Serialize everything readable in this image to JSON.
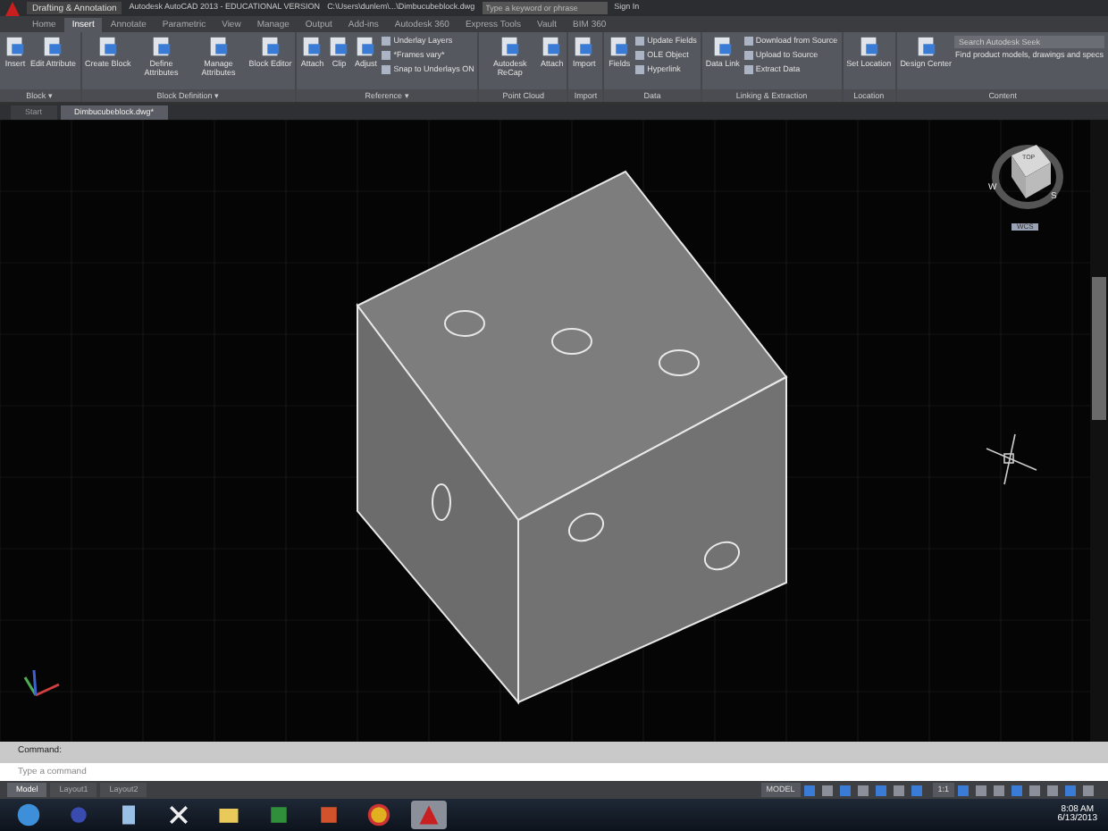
{
  "title_bar": {
    "workspace": "Drafting & Annotation",
    "title": "Autodesk AutoCAD 2013 - EDUCATIONAL VERSION",
    "file": "C:\\Users\\dunlem\\...\\Dimbucubeblock.dwg",
    "search": {
      "placeholder": "Type a keyword or phrase"
    },
    "sign_in": "Sign In"
  },
  "ribbon_tabs": [
    {
      "label": "Home",
      "selected": false
    },
    {
      "label": "Insert",
      "selected": true
    },
    {
      "label": "Annotate",
      "selected": false
    },
    {
      "label": "Parametric",
      "selected": false
    },
    {
      "label": "View",
      "selected": false
    },
    {
      "label": "Manage",
      "selected": false
    },
    {
      "label": "Output",
      "selected": false
    },
    {
      "label": "Add-ins",
      "selected": false
    },
    {
      "label": "Autodesk 360",
      "selected": false
    },
    {
      "label": "Express Tools",
      "selected": false
    },
    {
      "label": "Vault",
      "selected": false
    },
    {
      "label": "BIM 360",
      "selected": false
    }
  ],
  "ribbon_panels": [
    {
      "title": "Block ▾",
      "tools": [
        {
          "kind": "large",
          "label": "Insert"
        },
        {
          "kind": "large",
          "label": "Edit Attribute"
        }
      ]
    },
    {
      "title": "Block Definition ▾",
      "tools": [
        {
          "kind": "large",
          "label": "Create Block"
        },
        {
          "kind": "large",
          "label": "Define Attributes"
        },
        {
          "kind": "large",
          "label": "Manage Attributes"
        },
        {
          "kind": "large",
          "label": "Block Editor"
        }
      ]
    },
    {
      "title": "Reference ▾",
      "tools": [
        {
          "kind": "large",
          "label": "Attach"
        },
        {
          "kind": "large",
          "label": "Clip"
        },
        {
          "kind": "large",
          "label": "Adjust"
        },
        {
          "kind": "stack",
          "items": [
            "Underlay Layers",
            "*Frames vary*",
            "Snap to Underlays ON"
          ]
        }
      ]
    },
    {
      "title": "Point Cloud",
      "tools": [
        {
          "kind": "large",
          "label": "Autodesk ReCap"
        },
        {
          "kind": "large",
          "label": "Attach"
        }
      ]
    },
    {
      "title": "Import",
      "tools": [
        {
          "kind": "large",
          "label": "Import"
        }
      ]
    },
    {
      "title": "Data",
      "tools": [
        {
          "kind": "large",
          "label": "Fields"
        },
        {
          "kind": "stack",
          "items": [
            "Update Fields",
            "OLE Object",
            "Hyperlink"
          ]
        }
      ]
    },
    {
      "title": "Linking & Extraction",
      "tools": [
        {
          "kind": "large",
          "label": "Data Link"
        },
        {
          "kind": "stack",
          "items": [
            "Download from Source",
            "Upload to Source",
            "Extract Data"
          ]
        }
      ]
    },
    {
      "title": "Location",
      "tools": [
        {
          "kind": "large",
          "label": "Set Location"
        }
      ]
    },
    {
      "title": "Content",
      "tools": [
        {
          "kind": "large",
          "label": "Design Center"
        },
        {
          "kind": "search",
          "placeholder": "Search Autodesk Seek",
          "caption": "Find product models, drawings and specs"
        }
      ]
    }
  ],
  "file_tabs": [
    {
      "label": "Start",
      "selected": false
    },
    {
      "label": "Dimbucubeblock.dwg*",
      "selected": true
    }
  ],
  "viewcube": {
    "face": "TOP",
    "west": "W",
    "south": "S",
    "wcs": "WCS"
  },
  "command_line": {
    "history": "Command:",
    "input": {
      "placeholder": "Type a command"
    }
  },
  "layout_tabs": [
    {
      "label": "Model",
      "selected": true
    },
    {
      "label": "Layout1",
      "selected": false
    },
    {
      "label": "Layout2",
      "selected": false
    }
  ],
  "status_bar": {
    "model": "MODEL",
    "scale": "1:1"
  },
  "taskbar": {
    "apps": [
      {
        "kind": "start",
        "selected": false
      },
      {
        "kind": "media",
        "selected": false
      },
      {
        "kind": "document",
        "selected": false
      },
      {
        "kind": "x",
        "selected": false
      },
      {
        "kind": "folder",
        "selected": false
      },
      {
        "kind": "spreadsheet",
        "selected": false
      },
      {
        "kind": "slides",
        "selected": false
      },
      {
        "kind": "browser",
        "selected": false
      },
      {
        "kind": "cad",
        "selected": true
      }
    ],
    "time": "8:08 AM",
    "date": "6/13/2013"
  }
}
